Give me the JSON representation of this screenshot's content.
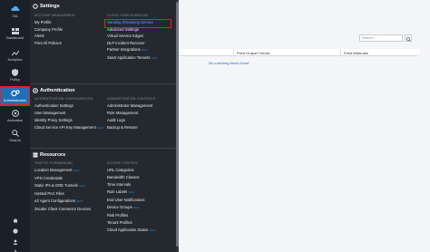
{
  "rail": {
    "items": [
      {
        "label": "ZIA"
      },
      {
        "label": "Dashboard"
      },
      {
        "label": "Analytics"
      },
      {
        "label": "Policy"
      },
      {
        "label": "Administration"
      },
      {
        "label": "Activation"
      },
      {
        "label": "Search"
      }
    ]
  },
  "menu": {
    "settings": {
      "title": "Settings",
      "col1_head": "ACCOUNT MANAGEMENT",
      "col1": [
        "My Profile",
        "Company Profile",
        "Alerts",
        "Print All Policies"
      ],
      "col2_head": "CLOUD CONFIGURATION",
      "col2": [
        "Nanolog Streaming Service",
        "Advanced Settings",
        "Virtual Service Edges",
        "DLP Incident Receiver",
        "Partner Integrations",
        "SaaS Application Tenants"
      ],
      "col2_badges": [
        "",
        "",
        "",
        "",
        "NEW",
        "NEW"
      ]
    },
    "authentication": {
      "title": "Authentication",
      "col1_head": "AUTHENTICATION CONFIGURATION",
      "col1": [
        "Authentication Settings",
        "User Management",
        "Identity Proxy Settings",
        "Cloud Service API Key Management"
      ],
      "col1_badges": [
        "",
        "",
        "",
        "NEW"
      ],
      "col2_head": "ADMINISTRATION CONTROLS",
      "col2": [
        "Administrator Management",
        "Role Management",
        "Audit Logs",
        "Backup & Restore"
      ]
    },
    "resources": {
      "title": "Resources",
      "col1_head": "TRAFFIC FORWARDING",
      "col1": [
        "Location Management",
        "VPN Credentials",
        "Static IPs & GRE Tunnels",
        "Hosted PAC Files",
        "eZ Agent Configurations",
        "Zscaler Client Connector Devices"
      ],
      "col1_badges": [
        "NEW",
        "",
        "NEW",
        "",
        "NEW",
        ""
      ],
      "col2_head": "ACCESS CONTROL",
      "col2": [
        "URL Categories",
        "Bandwidth Classes",
        "Time Intervals",
        "Rule Labels",
        "End User Notifications",
        "Device Groups",
        "Risk Profiles",
        "Tenant Profiles",
        "Cloud Application Status"
      ],
      "col2_badges": [
        "",
        "",
        "",
        "NEW",
        "",
        "NEW",
        "",
        "",
        "NEW"
      ]
    }
  },
  "main": {
    "search_placeholder": "Search...",
    "columns": [
      "Feed Output Format",
      "Feed Attributes"
    ],
    "empty_text": "No matching items found"
  },
  "colors": {
    "highlight": "#e0241b",
    "accent": "#1f6fb5"
  }
}
